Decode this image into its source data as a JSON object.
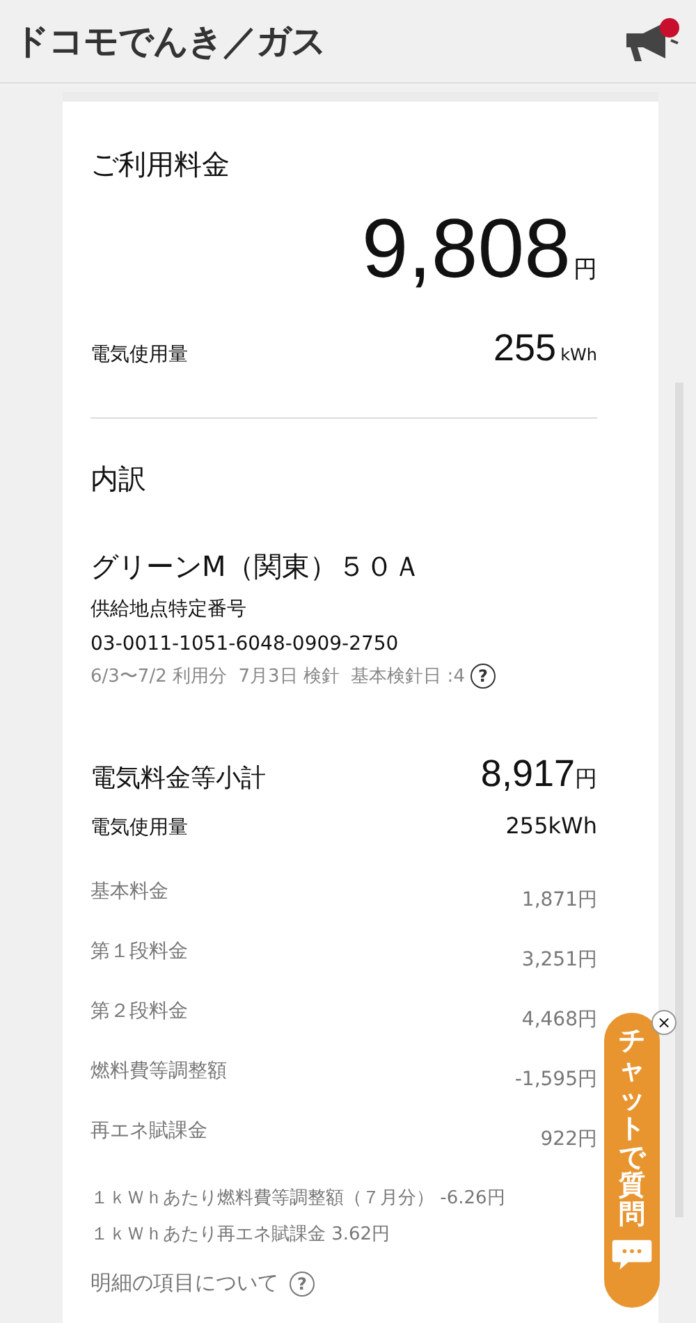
{
  "header": {
    "logo": "ドコモでんき／ガス",
    "has_notification": true
  },
  "summary": {
    "title": "ご利用料金",
    "amount": "9,808",
    "amount_unit": "円",
    "usage_label": "電気使用量",
    "usage": "255",
    "usage_unit": "kWh"
  },
  "breakdown": {
    "title": "内訳",
    "plan": "グリーンM（関東）５０Ａ",
    "supply_point_label": "供給地点特定番号",
    "supply_point_number": "03-0011-1051-6048-0909-2750",
    "period": "6/3〜7/2 利用分  7月3日 検針  基本検針日 :4",
    "help_icon": "?",
    "subtotal_label": "電気料金等小計",
    "subtotal": "8,917",
    "subtotal_unit": "円",
    "usage_label": "電気使用量",
    "usage": "255kWh",
    "items": [
      {
        "label": "基本料金",
        "value": "1,871円"
      },
      {
        "label": "第１段料金",
        "value": "3,251円"
      },
      {
        "label": "第２段料金",
        "value": "4,468円"
      },
      {
        "label": "燃料費等調整額",
        "value": "-1,595円"
      },
      {
        "label": "再エネ賦課金",
        "value": "922円"
      }
    ],
    "notes": [
      "１ｋＷｈあたり燃料費等調整額（７月分） -6.26円",
      "１ｋＷｈあたり再エネ賦課金 3.62円"
    ],
    "details_link": "明細の項目について",
    "details_help": "?"
  },
  "chat": {
    "label": "チャットで質問",
    "close": "×"
  }
}
